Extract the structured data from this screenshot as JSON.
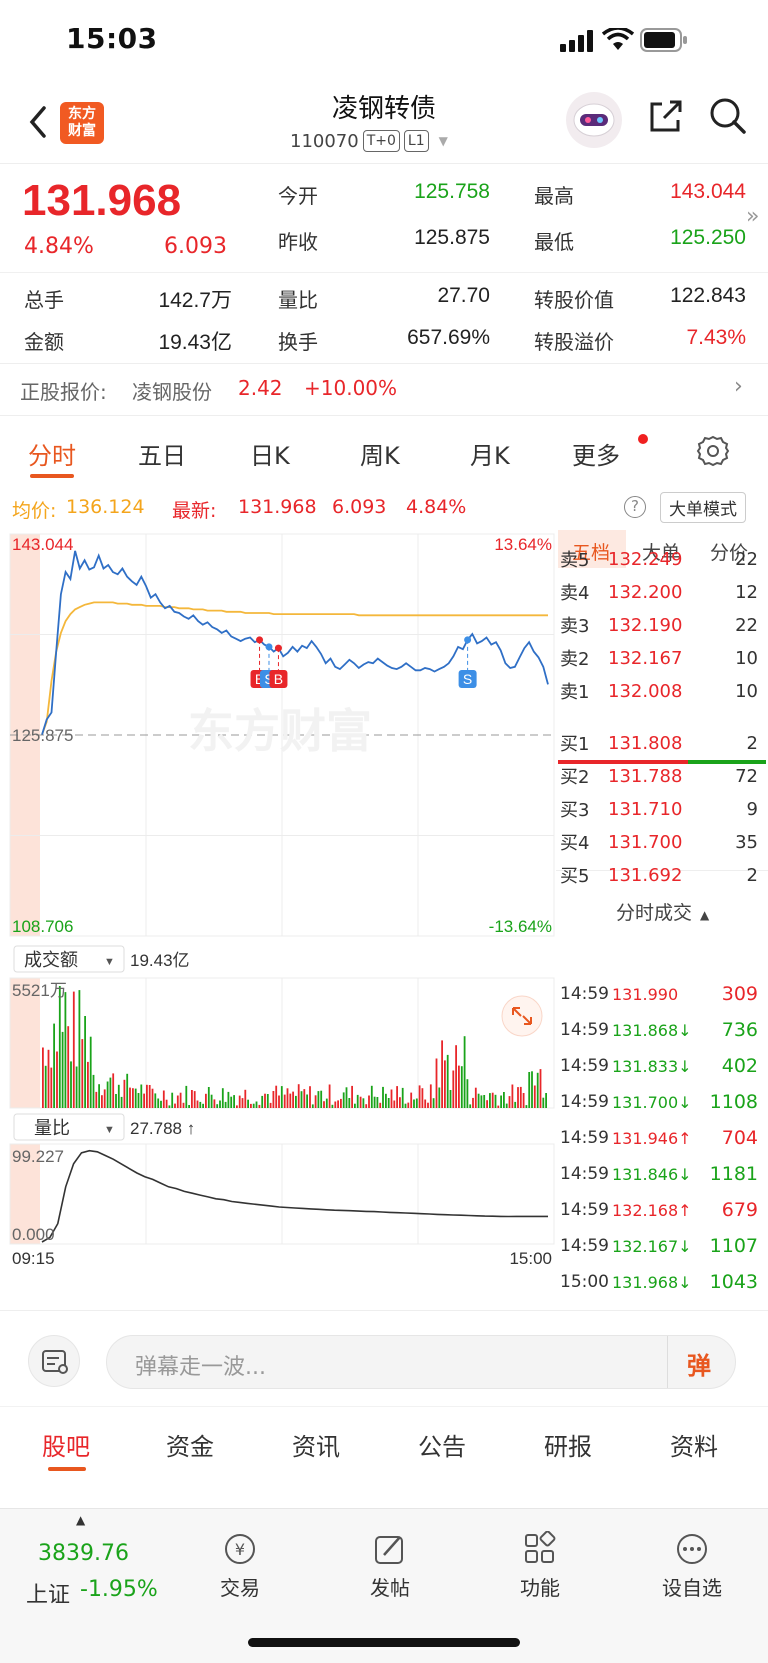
{
  "status": {
    "time": "15:03"
  },
  "header": {
    "title": "凌钢转债",
    "code": "110070",
    "tags": [
      "T+0",
      "L1"
    ],
    "logo_line1": "东方",
    "logo_line2": "财富"
  },
  "quote": {
    "price": "131.968",
    "pct": "4.84%",
    "change": "6.093",
    "fields": [
      {
        "label": "今开",
        "value": "125.758",
        "color": "green"
      },
      {
        "label": "最高",
        "value": "143.044",
        "color": "red"
      },
      {
        "label": "昨收",
        "value": "125.875",
        "color": "black"
      },
      {
        "label": "最低",
        "value": "125.250",
        "color": "green"
      },
      {
        "label": "总手",
        "value": "142.7万",
        "color": "black"
      },
      {
        "label": "量比",
        "value": "27.70",
        "color": "black"
      },
      {
        "label": "转股价值",
        "value": "122.843",
        "color": "black"
      },
      {
        "label": "金额",
        "value": "19.43亿",
        "color": "black"
      },
      {
        "label": "换手",
        "value": "657.69%",
        "color": "black"
      },
      {
        "label": "转股溢价",
        "value": "7.43%",
        "color": "red"
      }
    ]
  },
  "underlying": {
    "label": "正股报价:",
    "name": "凌钢股份",
    "price": "2.42",
    "pct": "+10.00%"
  },
  "chart_tabs": [
    "分时",
    "五日",
    "日K",
    "周K",
    "月K",
    "更多"
  ],
  "chart_info": {
    "avg_label": "均价:",
    "avg_value": "136.124",
    "latest_label": "最新:",
    "latest_value": "131.968",
    "latest_change": "6.093",
    "latest_pct": "4.84%",
    "mode_button": "大单模式"
  },
  "chart_data": {
    "type": "line",
    "y_top_label": "143.044",
    "y_mid_label": "125.875",
    "y_bottom_label": "108.706",
    "pct_top": "13.64%",
    "pct_bottom": "-13.64%",
    "x_start": "09:15",
    "x_end": "15:00",
    "ylim": [
      108.706,
      143.044
    ],
    "watermark": "东方财富",
    "series": [
      {
        "name": "价格",
        "color": "#2f6fc6",
        "values": [
          125.9,
          127.2,
          127.8,
          133.0,
          137.9,
          139.8,
          139.2,
          141.6,
          140.1,
          140.8,
          140.0,
          140.2,
          141.2,
          140.1,
          140.4,
          139.8,
          139.6,
          140.1,
          139.4,
          139.0,
          138.7,
          139.4,
          138.6,
          137.6,
          137.9,
          137.2,
          136.7,
          136.9,
          136.4,
          136.3,
          136.0,
          135.8,
          136.1,
          135.6,
          135.3,
          135.5,
          135.1,
          134.9,
          134.6,
          134.8,
          134.3,
          134.1,
          133.9,
          134.1,
          134.2,
          133.8,
          134.0,
          133.6,
          133.4,
          133.0,
          133.3,
          132.6,
          132.9,
          133.4,
          133.0,
          133.5,
          133.3,
          133.9,
          133.4,
          132.8,
          132.0,
          132.4,
          131.7,
          131.5,
          131.9,
          132.3,
          132.0,
          131.6,
          131.9,
          132.1,
          132.0,
          132.4,
          132.1,
          131.8,
          131.6,
          131.5,
          131.7,
          132.0,
          131.7,
          131.4,
          131.4,
          131.6,
          131.5,
          131.3,
          131.5,
          131.7,
          132.0,
          132.6,
          133.4,
          133.2,
          134.0,
          134.5,
          133.7,
          133.9,
          134.2,
          133.6,
          133.8,
          133.1,
          132.0,
          131.6,
          131.7,
          132.5,
          133.3,
          133.8,
          133.0,
          132.5,
          131.7,
          130.2
        ]
      },
      {
        "name": "均价",
        "color": "#f4b73b",
        "values": [
          125.9,
          127.0,
          130.5,
          133.0,
          134.6,
          135.6,
          136.2,
          136.6,
          136.8,
          137.0,
          137.1,
          137.2,
          137.2,
          137.2,
          137.2,
          137.2,
          137.1,
          137.1,
          137.1,
          137.0,
          137.0,
          137.0,
          136.9,
          136.9,
          136.9,
          136.9,
          136.8,
          136.8,
          136.8,
          136.7,
          136.7,
          136.7,
          136.6,
          136.6,
          136.6,
          136.5,
          136.5,
          136.5,
          136.5,
          136.4,
          136.4,
          136.4,
          136.4,
          136.3,
          136.3,
          136.3,
          136.3,
          136.3,
          136.3,
          136.2,
          136.2,
          136.2,
          136.2,
          136.2,
          136.2,
          136.2,
          136.2,
          136.2,
          136.2,
          136.2,
          136.2,
          136.2,
          136.2,
          136.2,
          136.2,
          136.2,
          136.2,
          136.1,
          136.1,
          136.1,
          136.1,
          136.1,
          136.1,
          136.1,
          136.1,
          136.1,
          136.1,
          136.1,
          136.1,
          136.1,
          136.1,
          136.1,
          136.1,
          136.1,
          136.1,
          136.1,
          136.1,
          136.1,
          136.1,
          136.1,
          136.1,
          136.1,
          136.1,
          136.1,
          136.1,
          136.1,
          136.1,
          136.1,
          136.1,
          136.1,
          136.1,
          136.1,
          136.1,
          136.1,
          136.1,
          136.1,
          136.1,
          136.1
        ]
      }
    ],
    "markers": [
      {
        "text": "B",
        "color": "#e8262a",
        "index": 46
      },
      {
        "text": "S",
        "color": "#3d8fe6",
        "index": 48
      },
      {
        "text": "B",
        "color": "#e8262a",
        "index": 50
      },
      {
        "text": "S",
        "color": "#3d8fe6",
        "index": 90
      }
    ],
    "volume": {
      "selector": "成交额",
      "value": "19.43亿",
      "top_label": "5521万"
    },
    "ratio": {
      "selector": "量比",
      "value": "27.788 ↑",
      "top_label": "99.227",
      "bottom_label": "0.000",
      "values": [
        0,
        5,
        20,
        60,
        85,
        97,
        99.2,
        98,
        94,
        90,
        85,
        80,
        75,
        71,
        68,
        64,
        60,
        58,
        55,
        53,
        51,
        49,
        47,
        46,
        44,
        43,
        42,
        41,
        40,
        39,
        38,
        37.5,
        37,
        36.5,
        36,
        35.5,
        35,
        34.6,
        34.3,
        34,
        33.6,
        33.3,
        33,
        32.6,
        32.2,
        31.9,
        31.5,
        31.2,
        30.8,
        30.4,
        30,
        29.7,
        29.4,
        29.1,
        28.8,
        28.5,
        28.2,
        28,
        27.8,
        27.7,
        27.8,
        27.8,
        27.8,
        27.8,
        27.8
      ]
    }
  },
  "panel_tabs": [
    "五档",
    "大单",
    "分价"
  ],
  "orderbook": {
    "asks": [
      {
        "label": "卖5",
        "price": "132.249",
        "qty": "22"
      },
      {
        "label": "卖4",
        "price": "132.200",
        "qty": "12"
      },
      {
        "label": "卖3",
        "price": "132.190",
        "qty": "22"
      },
      {
        "label": "卖2",
        "price": "132.167",
        "qty": "10"
      },
      {
        "label": "卖1",
        "price": "132.008",
        "qty": "10"
      }
    ],
    "bids": [
      {
        "label": "买1",
        "price": "131.808",
        "qty": "2"
      },
      {
        "label": "买2",
        "price": "131.788",
        "qty": "72"
      },
      {
        "label": "买3",
        "price": "131.710",
        "qty": "9"
      },
      {
        "label": "买4",
        "price": "131.700",
        "qty": "35"
      },
      {
        "label": "买5",
        "price": "131.692",
        "qty": "2"
      }
    ]
  },
  "trades": {
    "header": "分时成交",
    "rows": [
      {
        "time": "14:59",
        "price": "131.990",
        "arrow": "",
        "qty": "309",
        "color": "red"
      },
      {
        "time": "14:59",
        "price": "131.868",
        "arrow": "↓",
        "qty": "736",
        "color": "green"
      },
      {
        "time": "14:59",
        "price": "131.833",
        "arrow": "↓",
        "qty": "402",
        "color": "green"
      },
      {
        "time": "14:59",
        "price": "131.700",
        "arrow": "↓",
        "qty": "1108",
        "color": "green"
      },
      {
        "time": "14:59",
        "price": "131.946",
        "arrow": "↑",
        "qty": "704",
        "color": "red"
      },
      {
        "time": "14:59",
        "price": "131.846",
        "arrow": "↓",
        "qty": "1181",
        "color": "green"
      },
      {
        "time": "14:59",
        "price": "132.168",
        "arrow": "↑",
        "qty": "679",
        "color": "red"
      },
      {
        "time": "14:59",
        "price": "132.167",
        "arrow": "↓",
        "qty": "1107",
        "color": "green"
      },
      {
        "time": "15:00",
        "price": "131.968",
        "arrow": "↓",
        "qty": "1043",
        "color": "green"
      }
    ]
  },
  "danmu": {
    "placeholder": "弹幕走一波...",
    "button": "弹"
  },
  "guba_tabs": [
    "股吧",
    "资金",
    "资讯",
    "公告",
    "研报",
    "资料"
  ],
  "dock": {
    "index_value": "3839.76",
    "index_name": "上证",
    "index_pct": "-1.95%",
    "items": [
      "交易",
      "发帖",
      "功能",
      "设自选"
    ]
  },
  "colors": {
    "red": "#e8262a",
    "green": "#1aa31a",
    "blue": "#2f6fc6",
    "orange": "#e8571f",
    "avg": "#f4b73b"
  }
}
